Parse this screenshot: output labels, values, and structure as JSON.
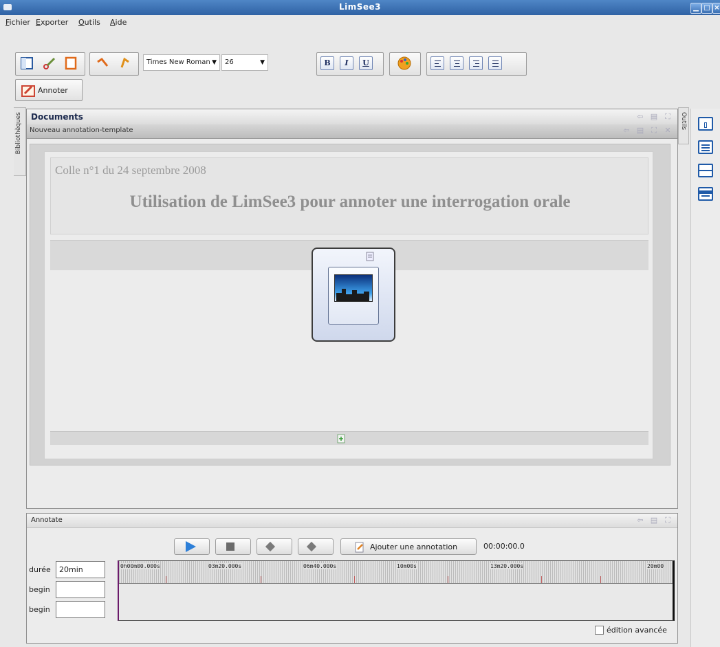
{
  "window": {
    "title": "LimSee3"
  },
  "menu": [
    "Fichier",
    "Exporter",
    "Outils",
    "Aide"
  ],
  "toolbar": {
    "font_family": "Times New Roman",
    "font_size": "26",
    "bold": "B",
    "italic": "I",
    "underline": "U",
    "annotate_label": "Annoter"
  },
  "side_tabs": {
    "left": "Bibliothèques",
    "right": "Outils"
  },
  "documents": {
    "panel_title": "Documents",
    "tab_title": "Nouveau annotation-template",
    "subtitle": "Colle n°1 du 24 septembre 2008",
    "title": "Utilisation de LimSee3 pour annoter une interrogation orale"
  },
  "annotate": {
    "panel_title": "Annotate",
    "add_annotation_label": "Ajouter une annotation",
    "time": "00:00:00.0",
    "duration_label": "durée",
    "duration_value": "20min",
    "begin_label_1": "begin",
    "begin_label_2": "begin",
    "ruler_labels": [
      "0h00m00.000s",
      "03m20.000s",
      "06m40.000s",
      "10m00s",
      "13m20.000s",
      "20m00"
    ],
    "advanced_label": "édition avancée"
  },
  "colors": {
    "title_bar": "#3a6fb3",
    "accent": "#2d7fd8"
  }
}
